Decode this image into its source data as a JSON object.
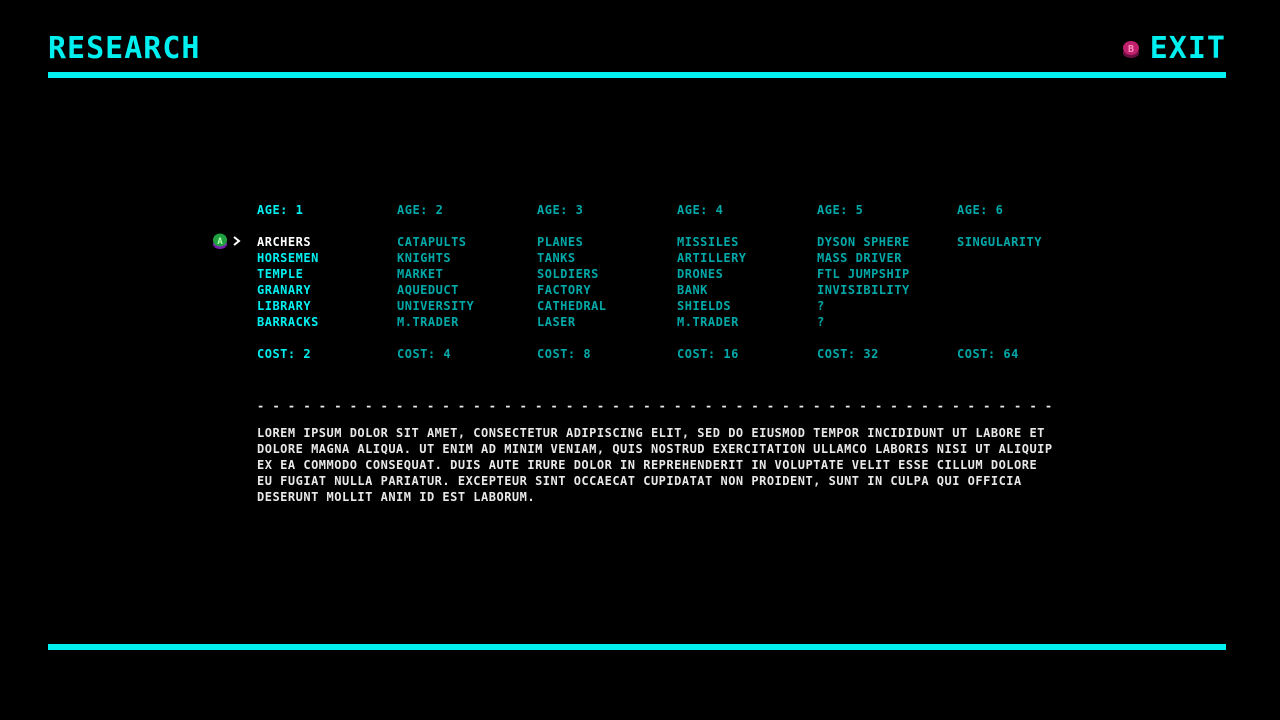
{
  "header": {
    "title": "RESEARCH",
    "exit_label": "EXIT",
    "exit_button_glyph": "B",
    "exit_button_icon": "b-button-icon"
  },
  "colors": {
    "accent": "#00f0f0",
    "dim": "#00a8a8",
    "selected": "#ffffff",
    "text": "#e8e8e8",
    "background": "#000000",
    "button_b": "#c0206c",
    "button_a": "#20a040"
  },
  "selection": {
    "button_glyph": "A",
    "button_icon": "a-button-icon",
    "pointer_icon": "pointer-arrow-icon",
    "age_index": 0,
    "item_index": 0
  },
  "research": {
    "ages": [
      {
        "label": "AGE: 1",
        "state": "available",
        "items": [
          "ARCHERS",
          "HORSEMEN",
          "TEMPLE",
          "GRANARY",
          "LIBRARY",
          "BARRACKS"
        ],
        "cost": "COST: 2"
      },
      {
        "label": "AGE: 2",
        "state": "locked",
        "items": [
          "CATAPULTS",
          "KNIGHTS",
          "MARKET",
          "AQUEDUCT",
          "UNIVERSITY",
          "M.TRADER"
        ],
        "cost": "COST: 4"
      },
      {
        "label": "AGE: 3",
        "state": "locked",
        "items": [
          "PLANES",
          "TANKS",
          "SOLDIERS",
          "FACTORY",
          "CATHEDRAL",
          "LASER"
        ],
        "cost": "COST: 8"
      },
      {
        "label": "AGE: 4",
        "state": "locked",
        "items": [
          "MISSILES",
          "ARTILLERY",
          "DRONES",
          "BANK",
          "SHIELDS",
          "M.TRADER"
        ],
        "cost": "COST: 16"
      },
      {
        "label": "AGE: 5",
        "state": "locked",
        "items": [
          "DYSON SPHERE",
          "MASS DRIVER",
          "FTL JUMPSHIP",
          "INVISIBILITY",
          "?",
          "?"
        ],
        "cost": "COST: 32"
      },
      {
        "label": "AGE: 6",
        "state": "locked",
        "items": [
          "SINGULARITY"
        ],
        "cost": "COST: 64"
      }
    ]
  },
  "divider": "- - - - - - - - - - - - - - - - - - - - - - - - - - - - - - - - - - - - - - - - - - - - - - - - - - - - - - - - - - - - - - - - - - -",
  "description": "LOREM IPSUM DOLOR SIT AMET, CONSECTETUR ADIPISCING ELIT, SED DO EIUSMOD TEMPOR INCIDIDUNT UT LABORE ET DOLORE MAGNA ALIQUA. UT ENIM AD MINIM VENIAM, QUIS NOSTRUD EXERCITATION ULLAMCO LABORIS NISI UT ALIQUIP EX EA COMMODO CONSEQUAT. DUIS AUTE IRURE DOLOR IN REPREHENDERIT IN VOLUPTATE VELIT ESSE CILLUM DOLORE EU FUGIAT NULLA PARIATUR. EXCEPTEUR SINT OCCAECAT CUPIDATAT NON PROIDENT, SUNT IN CULPA QUI OFFICIA DESERUNT MOLLIT ANIM ID EST LABORUM."
}
